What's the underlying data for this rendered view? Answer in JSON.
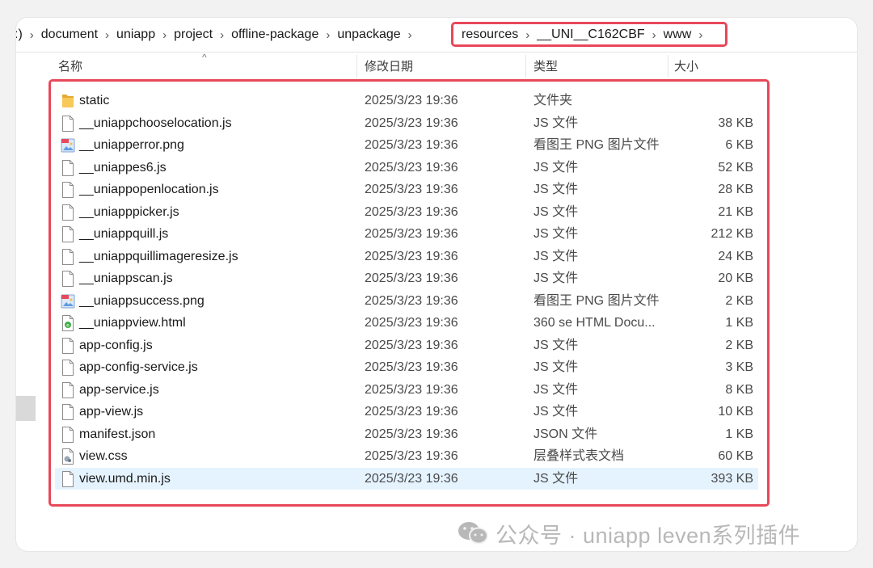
{
  "breadcrumb": {
    "items": [
      ":)",
      "document",
      "uniapp",
      "project",
      "offline-package",
      "unpackage"
    ],
    "highlighted": [
      "resources",
      "__UNI__C162CBF",
      "www"
    ],
    "separator": "›"
  },
  "columns": {
    "name": "名称",
    "date": "修改日期",
    "type": "类型",
    "size": "大小"
  },
  "files": [
    {
      "name": "static",
      "date": "2025/3/23 19:36",
      "type": "文件夹",
      "size": "",
      "icon": "folder-icon"
    },
    {
      "name": "__uniappchooselocation.js",
      "date": "2025/3/23 19:36",
      "type": "JS 文件",
      "size": "38 KB",
      "icon": "file-icon"
    },
    {
      "name": "__uniapperror.png",
      "date": "2025/3/23 19:36",
      "type": "看图王 PNG 图片文件",
      "size": "6 KB",
      "icon": "image-file-icon"
    },
    {
      "name": "__uniappes6.js",
      "date": "2025/3/23 19:36",
      "type": "JS 文件",
      "size": "52 KB",
      "icon": "file-icon"
    },
    {
      "name": "__uniappopenlocation.js",
      "date": "2025/3/23 19:36",
      "type": "JS 文件",
      "size": "28 KB",
      "icon": "file-icon"
    },
    {
      "name": "__uniapppicker.js",
      "date": "2025/3/23 19:36",
      "type": "JS 文件",
      "size": "21 KB",
      "icon": "file-icon"
    },
    {
      "name": "__uniappquill.js",
      "date": "2025/3/23 19:36",
      "type": "JS 文件",
      "size": "212 KB",
      "icon": "file-icon"
    },
    {
      "name": "__uniappquillimageresize.js",
      "date": "2025/3/23 19:36",
      "type": "JS 文件",
      "size": "24 KB",
      "icon": "file-icon"
    },
    {
      "name": "__uniappscan.js",
      "date": "2025/3/23 19:36",
      "type": "JS 文件",
      "size": "20 KB",
      "icon": "file-icon"
    },
    {
      "name": "__uniappsuccess.png",
      "date": "2025/3/23 19:36",
      "type": "看图王 PNG 图片文件",
      "size": "2 KB",
      "icon": "image-file-icon"
    },
    {
      "name": "__uniappview.html",
      "date": "2025/3/23 19:36",
      "type": "360 se HTML Docu...",
      "size": "1 KB",
      "icon": "html-file-icon"
    },
    {
      "name": "app-config.js",
      "date": "2025/3/23 19:36",
      "type": "JS 文件",
      "size": "2 KB",
      "icon": "file-icon"
    },
    {
      "name": "app-config-service.js",
      "date": "2025/3/23 19:36",
      "type": "JS 文件",
      "size": "3 KB",
      "icon": "file-icon"
    },
    {
      "name": "app-service.js",
      "date": "2025/3/23 19:36",
      "type": "JS 文件",
      "size": "8 KB",
      "icon": "file-icon"
    },
    {
      "name": "app-view.js",
      "date": "2025/3/23 19:36",
      "type": "JS 文件",
      "size": "10 KB",
      "icon": "file-icon"
    },
    {
      "name": "manifest.json",
      "date": "2025/3/23 19:36",
      "type": "JSON 文件",
      "size": "1 KB",
      "icon": "file-icon"
    },
    {
      "name": "view.css",
      "date": "2025/3/23 19:36",
      "type": "层叠样式表文档",
      "size": "60 KB",
      "icon": "css-file-icon"
    },
    {
      "name": "view.umd.min.js",
      "date": "2025/3/23 19:36",
      "type": "JS 文件",
      "size": "393 KB",
      "icon": "file-icon",
      "selected": true
    }
  ],
  "watermark": "公众号 · uniapp leven系列插件",
  "colors": {
    "highlight": "#e8485a",
    "selection": "#e5f3ff",
    "folder": "#f3c04a"
  }
}
